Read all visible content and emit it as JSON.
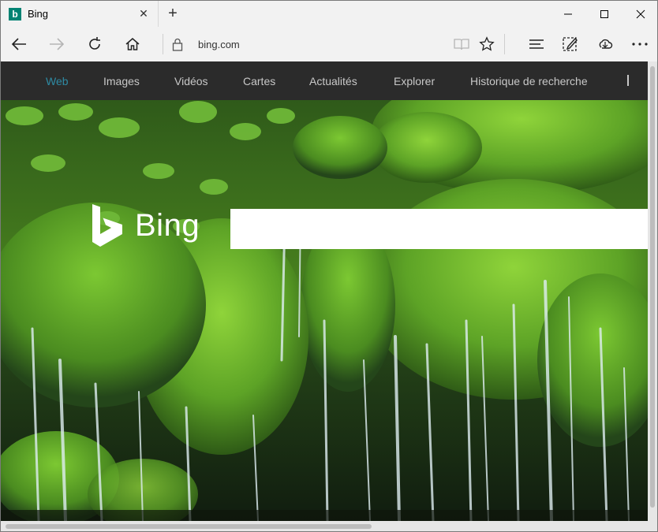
{
  "tab": {
    "title": "Bing",
    "favicon_letter": "b",
    "close": "✕"
  },
  "new_tab": "+",
  "window_controls": {
    "minimize": "minimize-icon",
    "maximize": "maximize-icon",
    "close": "close-icon"
  },
  "address_bar": {
    "url": "bing.com"
  },
  "toolbar_icons": [
    "back-icon",
    "forward-icon",
    "refresh-icon",
    "home-icon",
    "reading-view-icon",
    "favorite-star-icon",
    "hub-icon",
    "web-note-icon",
    "share-icon",
    "more-icon"
  ],
  "nav": {
    "items": [
      "Web",
      "Images",
      "Vidéos",
      "Cartes",
      "Actualités",
      "Explorer",
      "Historique de recherche"
    ],
    "active": "Web"
  },
  "logo": {
    "text": "Bing"
  },
  "search": {
    "value": ""
  },
  "colors": {
    "nav_bg": "#2b2b2b",
    "nav_active": "#2e8ba4",
    "favicon": "#008373"
  }
}
